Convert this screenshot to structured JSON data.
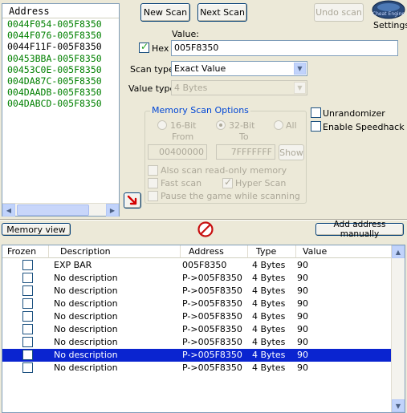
{
  "address_list": {
    "header": "Address",
    "rows": [
      {
        "text": "0044F054-005F8350",
        "color": "#008000"
      },
      {
        "text": "0044F076-005F8350",
        "color": "#008000"
      },
      {
        "text": "0044F11F-005F8350",
        "color": "#000000"
      },
      {
        "text": "00453BBA-005F8350",
        "color": "#008000"
      },
      {
        "text": "00453C0E-005F8350",
        "color": "#008000"
      },
      {
        "text": "004DA87C-005F8350",
        "color": "#008000"
      },
      {
        "text": "004DAADB-005F8350",
        "color": "#008000"
      },
      {
        "text": "004DABCD-005F8350",
        "color": "#008000"
      }
    ]
  },
  "buttons": {
    "new_scan": "New Scan",
    "next_scan": "Next Scan",
    "undo_scan": "Undo scan",
    "settings": "Settings",
    "memory_view": "Memory view",
    "add_address": "Add address manually",
    "show": "Show"
  },
  "value": {
    "label": "Value:",
    "hex_label": "Hex",
    "hex_checked": true,
    "current": "005F8350"
  },
  "scan_type": {
    "label": "Scan type",
    "selected": "Exact Value"
  },
  "value_type": {
    "label": "Value type",
    "selected": "4 Bytes"
  },
  "memory_scan_options": {
    "title": "Memory Scan Options",
    "radio_16": "16-Bit",
    "radio_32": "32-Bit",
    "radio_all": "All",
    "from_label": "From",
    "to_label": "To",
    "from_value": "00400000",
    "to_value": "7FFFFFFF",
    "also_readonly": "Also scan read-only memory",
    "fast_scan": "Fast scan",
    "hyper_scan": "Hyper Scan",
    "pause_game": "Pause the game while scanning"
  },
  "options": {
    "unrandomizer": "Unrandomizer",
    "speedhack": "Enable Speedhack"
  },
  "table": {
    "columns": [
      "Frozen",
      "Description",
      "Address",
      "Type",
      "Value"
    ],
    "rows": [
      {
        "description": "EXP BAR",
        "address": "005F8350",
        "type": "4 Bytes",
        "value": "90",
        "selected": false
      },
      {
        "description": "No description",
        "address": "P->005F8350",
        "type": "4 Bytes",
        "value": "90",
        "selected": false
      },
      {
        "description": "No description",
        "address": "P->005F8350",
        "type": "4 Bytes",
        "value": "90",
        "selected": false
      },
      {
        "description": "No description",
        "address": "P->005F8350",
        "type": "4 Bytes",
        "value": "90",
        "selected": false
      },
      {
        "description": "No description",
        "address": "P->005F8350",
        "type": "4 Bytes",
        "value": "90",
        "selected": false
      },
      {
        "description": "No description",
        "address": "P->005F8350",
        "type": "4 Bytes",
        "value": "90",
        "selected": false
      },
      {
        "description": "No description",
        "address": "P->005F8350",
        "type": "4 Bytes",
        "value": "90",
        "selected": false
      },
      {
        "description": "No description",
        "address": "P->005F8350",
        "type": "4 Bytes",
        "value": "90",
        "selected": true
      },
      {
        "description": "No description",
        "address": "P->005F8350",
        "type": "4 Bytes",
        "value": "90",
        "selected": false
      }
    ]
  },
  "colors": {
    "window_bg": "#ece9d8",
    "selection": "#0a24d0",
    "address_green": "#008000",
    "group_title": "#0046d5"
  },
  "icons": {
    "cheat_engine_logo": "cheat-engine-logo",
    "add_arrow": "red-arrow-icon",
    "stop": "stop-icon"
  },
  "logo_text": "Cheat Engine"
}
